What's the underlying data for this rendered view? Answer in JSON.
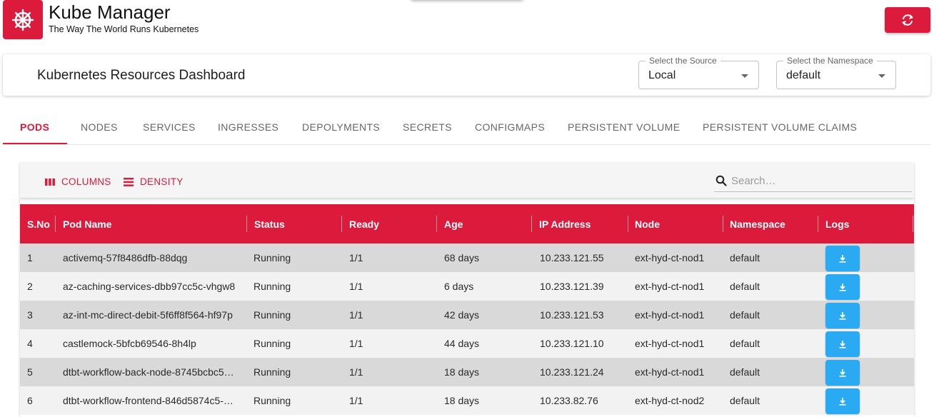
{
  "header": {
    "title": "Kube Manager",
    "subtitle": "The Way The World Runs Kubernetes",
    "logo_icon": "kubernetes-helm-icon",
    "refresh_icon": "refresh-icon"
  },
  "dashboard": {
    "title": "Kubernetes Resources Dashboard",
    "source_select": {
      "label": "Select the Source",
      "value": "Local"
    },
    "namespace_select": {
      "label": "Select the Namespace",
      "value": "default"
    }
  },
  "tabs": [
    "PODS",
    "NODES",
    "SERVICES",
    "INGRESSES",
    "DEPOLYMENTS",
    "SECRETS",
    "CONFIGMAPS",
    "PERSISTENT VOLUME",
    "PERSISTENT VOLUME CLAIMS"
  ],
  "active_tab": "PODS",
  "toolbar": {
    "columns_label": "COLUMNS",
    "density_label": "DENSITY",
    "search_placeholder": "Search…"
  },
  "table": {
    "columns": [
      "S.No",
      "Pod Name",
      "Status",
      "Ready",
      "Age",
      "IP Address",
      "Node",
      "Namespace",
      "Logs"
    ],
    "rows": [
      [
        "1",
        "activemq-57f8486dfb-88dqg",
        "Running",
        "1/1",
        "68 days",
        "10.233.121.55",
        "ext-hyd-ct-nod1",
        "default"
      ],
      [
        "2",
        "az-caching-services-dbb97cc5c-vhgw8",
        "Running",
        "1/1",
        "6 days",
        "10.233.121.39",
        "ext-hyd-ct-nod1",
        "default"
      ],
      [
        "3",
        "az-int-mc-direct-debit-5f6ff8f564-hf97p",
        "Running",
        "1/1",
        "42 days",
        "10.233.121.53",
        "ext-hyd-ct-nod1",
        "default"
      ],
      [
        "4",
        "castlemock-5bfcb69546-8h4lp",
        "Running",
        "1/1",
        "44 days",
        "10.233.121.10",
        "ext-hyd-ct-nod1",
        "default"
      ],
      [
        "5",
        "dtbt-workflow-back-node-8745bcbc5…",
        "Running",
        "1/1",
        "18 days",
        "10.233.121.24",
        "ext-hyd-ct-nod1",
        "default"
      ],
      [
        "6",
        "dtbt-workflow-frontend-846d5874c5-…",
        "Running",
        "1/1",
        "18 days",
        "10.233.82.76",
        "ext-hyd-ct-nod2",
        "default"
      ]
    ]
  },
  "colors": {
    "primary": "#dc1a3c",
    "download_button": "#29aaf2"
  }
}
